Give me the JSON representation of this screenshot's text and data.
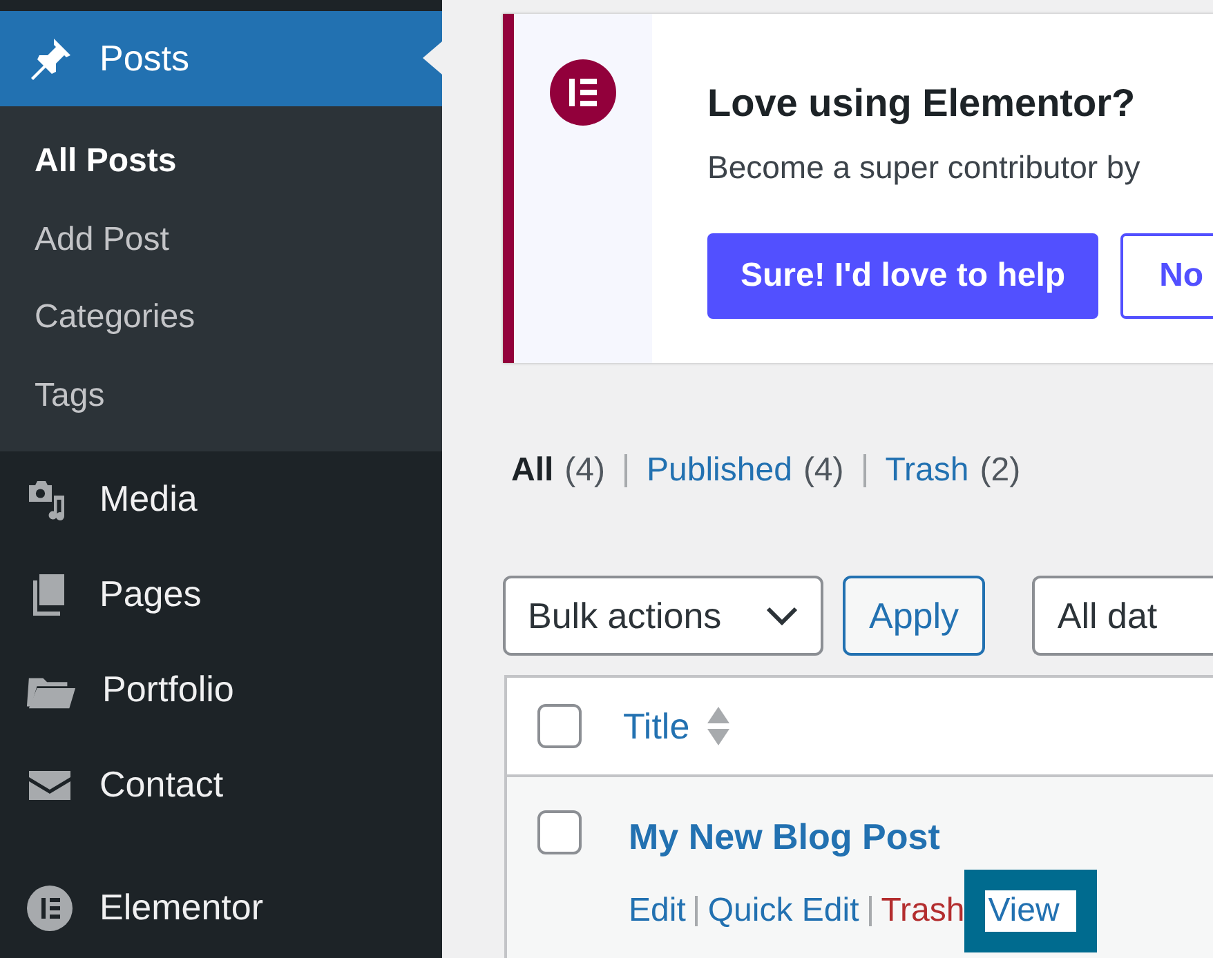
{
  "sidebar": {
    "menu": [
      {
        "label": "Posts",
        "kind": "pin",
        "selected": true,
        "children": [
          {
            "label": "All Posts",
            "selected": true
          },
          {
            "label": "Add Post",
            "selected": false
          },
          {
            "label": "Categories",
            "selected": false
          },
          {
            "label": "Tags",
            "selected": false
          }
        ]
      },
      {
        "label": "Media",
        "kind": "media",
        "selected": false
      },
      {
        "label": "Pages",
        "kind": "pages",
        "selected": false
      },
      {
        "label": "Portfolio",
        "kind": "folder",
        "selected": false
      },
      {
        "label": "Contact",
        "kind": "mail",
        "selected": false
      },
      {
        "label": "Elementor",
        "kind": "elementor",
        "selected": false
      }
    ]
  },
  "notice": {
    "title": "Love using Elementor?",
    "text": "Become a super contributor by",
    "primary_button": "Sure! I'd love to help",
    "secondary_button": "No"
  },
  "filters": [
    {
      "label": "All",
      "count": "(4)",
      "selected": true
    },
    {
      "label": "Published",
      "count": "(4)",
      "selected": false
    },
    {
      "label": "Trash",
      "count": "(2)",
      "selected": false
    }
  ],
  "toolbar": {
    "bulk_select": "Bulk actions",
    "apply_button": "Apply",
    "date_select": "All dat"
  },
  "table": {
    "header_checked": false,
    "column": "Title",
    "rows": [
      {
        "title": "My New Blog Post",
        "checked": false,
        "actions": [
          {
            "label": "Edit",
            "kind": "link",
            "focused": false
          },
          {
            "label": "Quick Edit",
            "kind": "link",
            "focused": false
          },
          {
            "label": "Trash",
            "kind": "delete",
            "focused": false
          },
          {
            "label": "View",
            "kind": "link",
            "focused": true
          }
        ]
      }
    ]
  }
}
